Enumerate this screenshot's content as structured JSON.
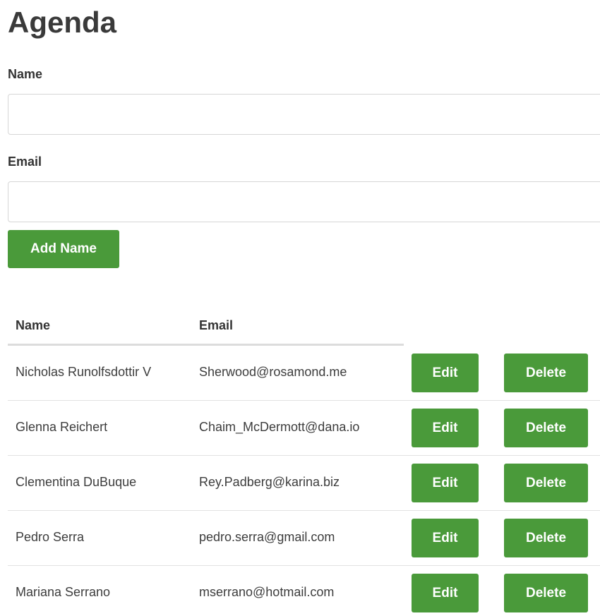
{
  "page": {
    "title": "Agenda"
  },
  "form": {
    "name_label": "Name",
    "name_value": "",
    "email_label": "Email",
    "email_value": "",
    "add_button_label": "Add Name"
  },
  "table": {
    "headers": [
      "Name",
      "Email"
    ],
    "edit_label": "Edit",
    "delete_label": "Delete",
    "rows": [
      {
        "name": "Nicholas Runolfsdottir V",
        "email": "Sherwood@rosamond.me"
      },
      {
        "name": "Glenna Reichert",
        "email": "Chaim_McDermott@dana.io"
      },
      {
        "name": "Clementina DuBuque",
        "email": "Rey.Padberg@karina.biz"
      },
      {
        "name": "Pedro Serra",
        "email": "pedro.serra@gmail.com"
      },
      {
        "name": "Mariana Serrano",
        "email": "mserrano@hotmail.com"
      }
    ]
  },
  "colors": {
    "button_green": "#4a9a3a"
  }
}
